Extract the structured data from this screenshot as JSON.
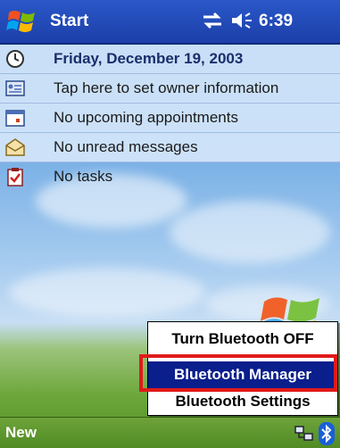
{
  "title_bar": {
    "start_label": "Start",
    "time": "6:39",
    "icons": [
      "windows-logo-icon",
      "connectivity-icon",
      "volume-icon"
    ]
  },
  "today": {
    "date": "Friday, December 19, 2003",
    "owner": "Tap here to set owner information",
    "appointments": "No upcoming appointments",
    "messages": "No unread messages",
    "tasks": "No tasks"
  },
  "popup_menu": {
    "items": [
      "Turn Bluetooth OFF",
      "Bluetooth Manager",
      "Bluetooth Settings"
    ],
    "selected": "Bluetooth Manager",
    "highlight_color": "#e11a1a"
  },
  "bottom_bar": {
    "new_label": "New",
    "icons": [
      "network-icon",
      "bluetooth-icon"
    ]
  }
}
